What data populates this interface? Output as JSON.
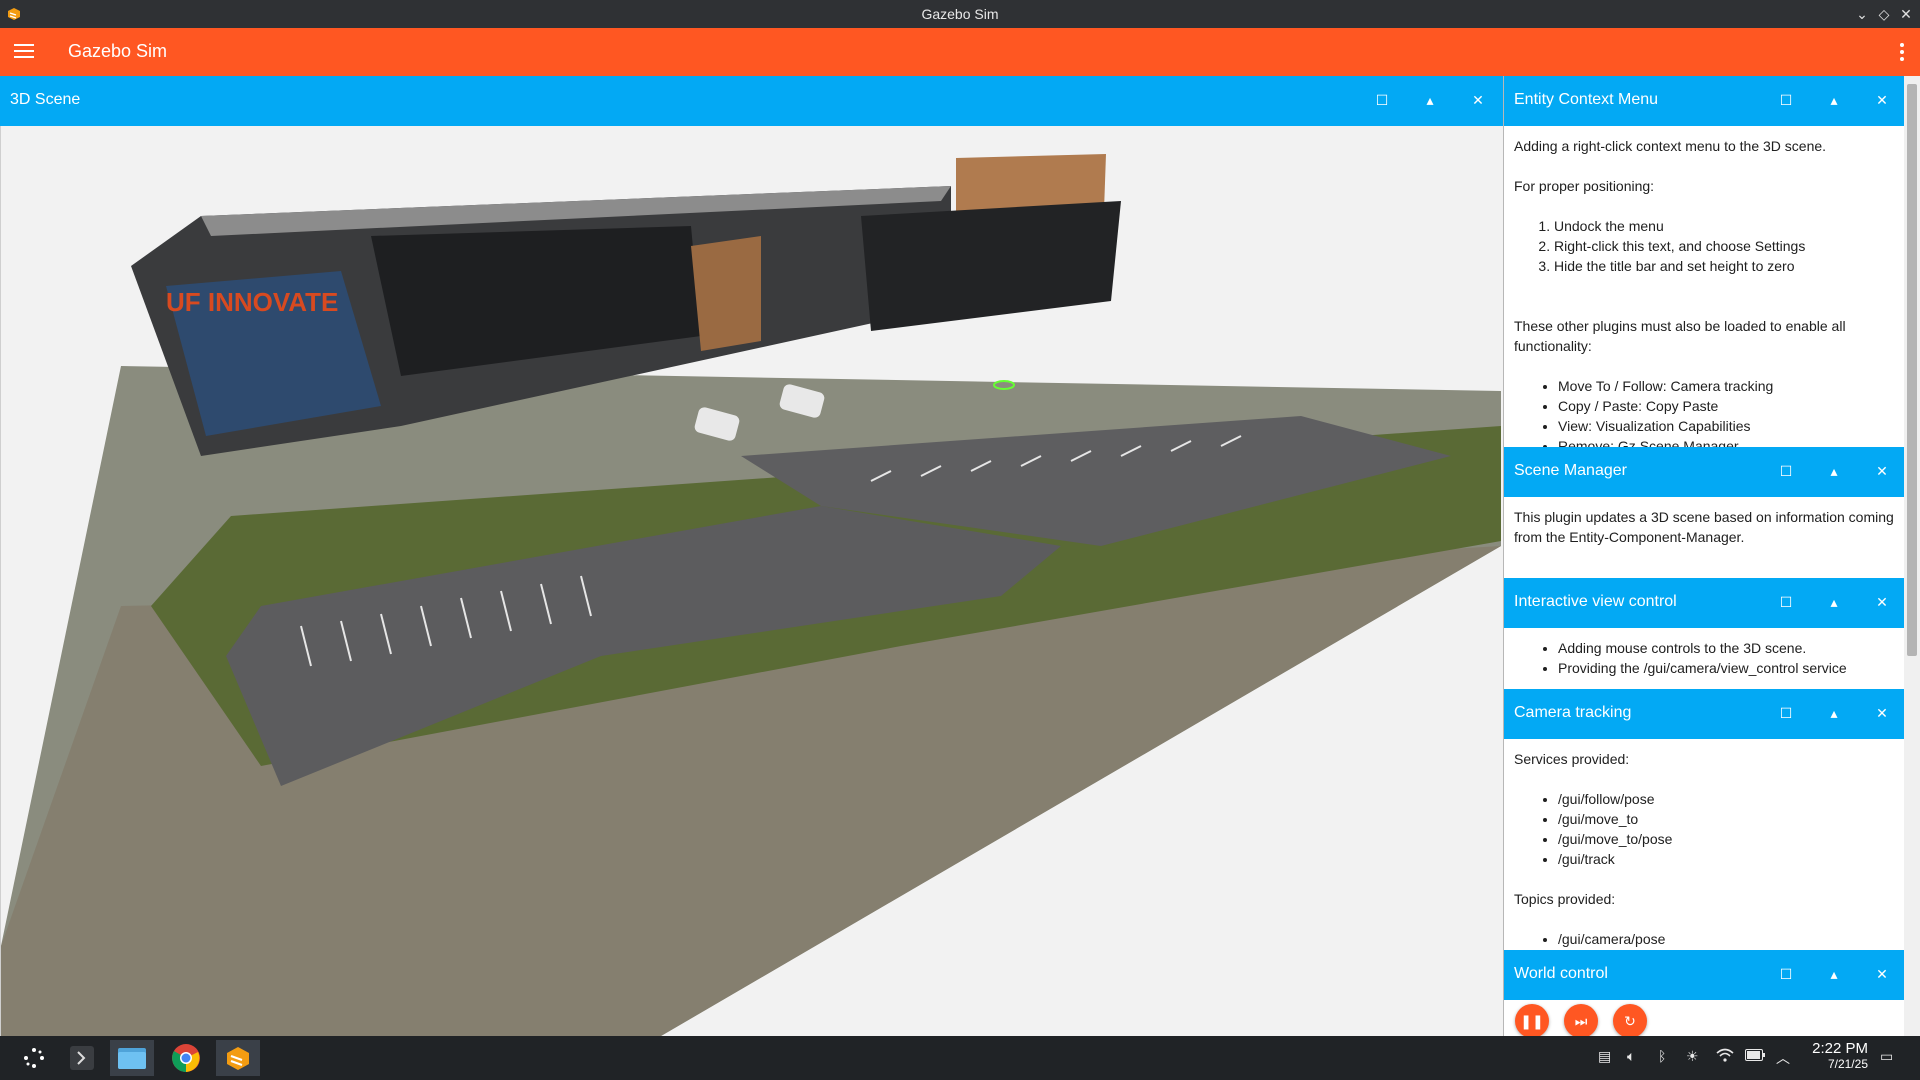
{
  "window": {
    "title": "Gazebo Sim",
    "controls": {
      "minimize": "⌄",
      "maximize": "◇",
      "close": "✕"
    }
  },
  "appbar": {
    "title": "Gazebo Sim",
    "accent_color": "#ff5722"
  },
  "panel_header_color": "#03a9f4",
  "panel_controls": {
    "float": "☐",
    "collapse": "▴",
    "close": "✕"
  },
  "scene_panel": {
    "title": "3D Scene",
    "sign_text": "UF INNOVATE"
  },
  "entity_context_menu": {
    "title": "Entity Context Menu",
    "intro": "Adding a right-click context menu to the 3D scene.",
    "positioning_heading": "For proper positioning:",
    "steps": [
      "Undock the menu",
      "Right-click this text, and choose Settings",
      "Hide the title bar and set height to zero"
    ],
    "plugins_heading": "These other plugins must also be loaded to enable all functionality:",
    "plugins": [
      "Move To / Follow: Camera tracking",
      "Copy / Paste: Copy Paste",
      "View: Visualization Capabilities",
      "Remove: Gz Scene Manager"
    ]
  },
  "scene_manager": {
    "title": "Scene Manager",
    "text": "This plugin updates a 3D scene based on information coming from the Entity-Component-Manager."
  },
  "interactive_view_control": {
    "title": "Interactive view control",
    "items": [
      "Adding mouse controls to the 3D scene.",
      "Providing the /gui/camera/view_control service"
    ]
  },
  "camera_tracking": {
    "title": "Camera tracking",
    "services_heading": "Services provided:",
    "services": [
      "/gui/follow/pose",
      "/gui/move_to",
      "/gui/move_to/pose",
      "/gui/track"
    ],
    "topics_heading": "Topics provided:",
    "topics": [
      "/gui/camera/pose"
    ]
  },
  "world_control": {
    "title": "World control",
    "buttons": [
      "pause-icon",
      "step-icon",
      "reset-icon"
    ]
  },
  "taskbar": {
    "apps": [
      "launcher-icon",
      "terminal-icon",
      "file-manager-icon",
      "chrome-icon",
      "gazebo-icon"
    ],
    "tray": [
      "clipboard-icon",
      "volume-icon",
      "bluetooth-icon",
      "brightness-icon",
      "wifi-icon",
      "battery-icon",
      "tray-expand-icon"
    ],
    "time": "2:22 PM",
    "date": "7/21/25"
  }
}
